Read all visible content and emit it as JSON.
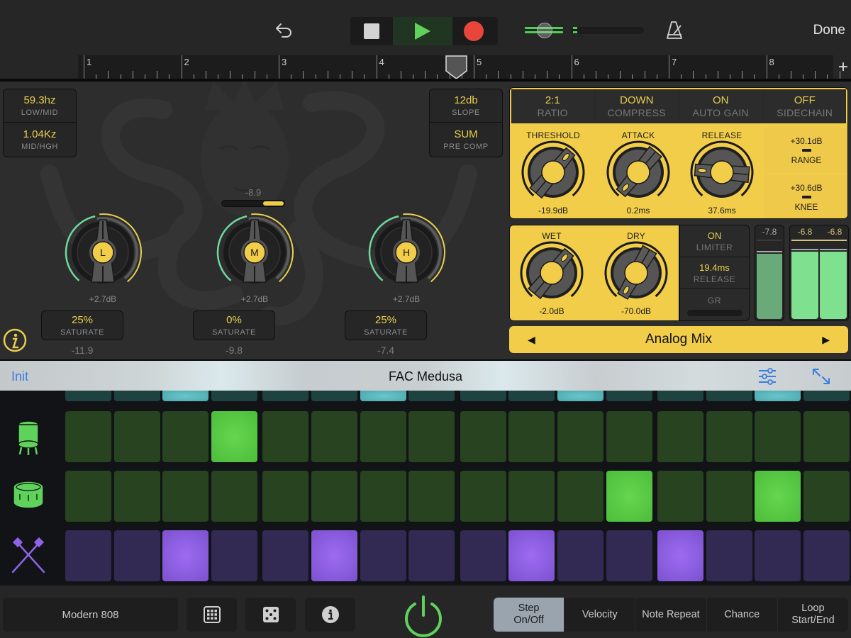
{
  "topbar": {
    "done_label": "Done",
    "icons": {
      "undo": "undo-arrow-icon",
      "stop": "stop-icon",
      "play": "play-icon",
      "record": "record-icon",
      "metronome": "metronome-icon"
    },
    "master_volume": 0.32
  },
  "ruler": {
    "bars": [
      "1",
      "2",
      "3",
      "4",
      "5",
      "6",
      "7",
      "8"
    ],
    "playhead_bar": 4.85,
    "add_label": "+"
  },
  "plugin": {
    "crossover": [
      {
        "value": "59.3hz",
        "label": "LOW/MID"
      },
      {
        "value": "1.04Kz",
        "label": "MID/HGH"
      }
    ],
    "options": [
      {
        "value": "12db",
        "label": "SLOPE"
      },
      {
        "value": "SUM",
        "label": "PRE COMP"
      }
    ],
    "input_level": {
      "value": "-8.9",
      "fraction": 0.33
    },
    "bands": [
      {
        "letter": "L",
        "gain": "+2.7dB",
        "saturate_value": "25%",
        "saturate_label": "SATURATE",
        "level": "-11.9"
      },
      {
        "letter": "M",
        "gain": "+2.7dB",
        "saturate_value": "0%",
        "saturate_label": "SATURATE",
        "level": "-9.8"
      },
      {
        "letter": "H",
        "gain": "+2.7dB",
        "saturate_value": "25%",
        "saturate_label": "SATURATE",
        "level": "-7.4"
      }
    ],
    "compressor": {
      "buttons": [
        {
          "value": "2:1",
          "label": "RATIO"
        },
        {
          "value": "DOWN",
          "label": "COMPRESS"
        },
        {
          "value": "ON",
          "label": "AUTO GAIN"
        },
        {
          "value": "OFF",
          "label": "SIDECHAIN"
        }
      ],
      "knobs": [
        {
          "name": "THRESHOLD",
          "value": "-19.9dB"
        },
        {
          "name": "ATTACK",
          "value": "0.2ms"
        },
        {
          "name": "RELEASE",
          "value": "37.6ms"
        }
      ],
      "range": {
        "value": "+30.1dB",
        "label": "RANGE"
      },
      "knee": {
        "value": "+30.6dB",
        "label": "KNEE"
      }
    },
    "mix": {
      "knobs": [
        {
          "name": "WET",
          "value": "-2.0dB"
        },
        {
          "name": "DRY",
          "value": "-70.0dB"
        }
      ]
    },
    "limiter": {
      "state": {
        "value": "ON",
        "label": "LIMITER"
      },
      "release": {
        "value": "19.4ms",
        "label": "RELEASE"
      },
      "gr_label": "GR"
    },
    "meters": {
      "input": {
        "value": "-7.8"
      },
      "output_left": {
        "value": "-6.8"
      },
      "output_right": {
        "value": "-6.8"
      }
    },
    "preset": {
      "name": "Analog Mix",
      "prev": "◀",
      "next": "▶"
    },
    "info_icon": "info-circle-icon"
  },
  "header": {
    "init_label": "Init",
    "title": "FAC Medusa",
    "icons": {
      "settings": "sliders-icon",
      "expand": "expand-arrows-icon"
    }
  },
  "sequencer": {
    "steps": 16,
    "lanes": [
      {
        "name": "hihat-lane",
        "icon": "hihat-icon",
        "color": "teal",
        "active": [
          3,
          7,
          11,
          15
        ]
      },
      {
        "name": "kick-lane",
        "icon": "kick-drum-icon",
        "color": "green",
        "active": [
          4
        ]
      },
      {
        "name": "snare-lane",
        "icon": "snare-drum-icon",
        "color": "green",
        "active": [
          12,
          15
        ]
      },
      {
        "name": "sticks-lane",
        "icon": "drumsticks-icon",
        "color": "purple",
        "active": [
          3,
          6,
          10,
          13
        ]
      }
    ]
  },
  "bottom": {
    "kit_label": "Modern 808",
    "icons": {
      "grid": "pad-grid-icon",
      "dice": "dice-icon",
      "info": "info-icon",
      "power": "power-icon"
    },
    "modes": [
      {
        "label": "Step\nOn/Off",
        "active": true
      },
      {
        "label": "Velocity",
        "active": false
      },
      {
        "label": "Note Repeat",
        "active": false
      },
      {
        "label": "Chance",
        "active": false
      },
      {
        "label": "Loop\nStart/End",
        "active": false
      }
    ]
  },
  "colors": {
    "accent_yellow": "#f2cd49",
    "green_active": "#5fd25c",
    "record_red": "#e8463b",
    "link_blue": "#3a7de0"
  }
}
